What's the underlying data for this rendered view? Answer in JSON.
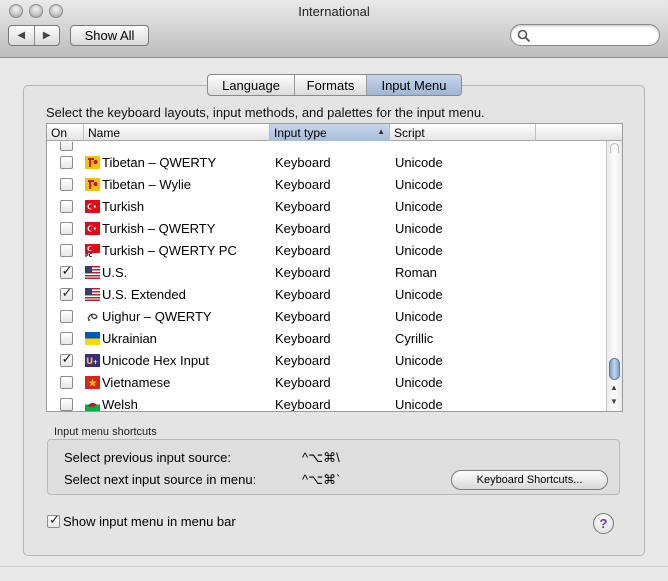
{
  "window": {
    "title": "International"
  },
  "toolbar": {
    "back_icon": "◀",
    "forward_icon": "▶",
    "show_all_label": "Show All",
    "search_placeholder": ""
  },
  "tabs": [
    {
      "label": "Language",
      "active": false
    },
    {
      "label": "Formats",
      "active": false
    },
    {
      "label": "Input Menu",
      "active": true
    }
  ],
  "instruction": "Select the keyboard layouts, input methods, and palettes for the input menu.",
  "table": {
    "headers": {
      "on": "On",
      "name": "Name",
      "input_type": "Input type",
      "script": "Script"
    },
    "sort_indicator": "▲",
    "rows": [
      {
        "checked": false,
        "name": "",
        "type": "",
        "script": "",
        "flag": "none",
        "partial": true
      },
      {
        "checked": false,
        "name": "Tibetan – QWERTY",
        "type": "Keyboard",
        "script": "Unicode",
        "flag": "tibetan"
      },
      {
        "checked": false,
        "name": "Tibetan – Wylie",
        "type": "Keyboard",
        "script": "Unicode",
        "flag": "tibetan"
      },
      {
        "checked": false,
        "name": "Turkish",
        "type": "Keyboard",
        "script": "Unicode",
        "flag": "turkey"
      },
      {
        "checked": false,
        "name": "Turkish – QWERTY",
        "type": "Keyboard",
        "script": "Unicode",
        "flag": "turkey"
      },
      {
        "checked": false,
        "name": "Turkish – QWERTY PC",
        "type": "Keyboard",
        "script": "Unicode",
        "flag": "turkey-pc"
      },
      {
        "checked": true,
        "name": "U.S.",
        "type": "Keyboard",
        "script": "Roman",
        "flag": "us"
      },
      {
        "checked": true,
        "name": "U.S. Extended",
        "type": "Keyboard",
        "script": "Unicode",
        "flag": "us"
      },
      {
        "checked": false,
        "name": "Uighur – QWERTY",
        "type": "Keyboard",
        "script": "Unicode",
        "flag": "uighur"
      },
      {
        "checked": false,
        "name": "Ukrainian",
        "type": "Keyboard",
        "script": "Cyrillic",
        "flag": "ukraine"
      },
      {
        "checked": true,
        "name": "Unicode Hex Input",
        "type": "Keyboard",
        "script": "Unicode",
        "flag": "unicode"
      },
      {
        "checked": false,
        "name": "Vietnamese",
        "type": "Keyboard",
        "script": "Unicode",
        "flag": "vietnam"
      },
      {
        "checked": false,
        "name": "Welsh",
        "type": "Keyboard",
        "script": "Unicode",
        "flag": "wales"
      }
    ]
  },
  "shortcuts": {
    "title": "Input menu shortcuts",
    "previous_label": "Select previous input source:",
    "previous_key": "^⌥⌘\\",
    "next_label": "Select next input source in menu:",
    "next_key": "^⌥⌘`",
    "button_label": "Keyboard Shortcuts..."
  },
  "show_menu": {
    "label": "Show input menu in menu bar",
    "checked": true
  },
  "help_label": "?"
}
